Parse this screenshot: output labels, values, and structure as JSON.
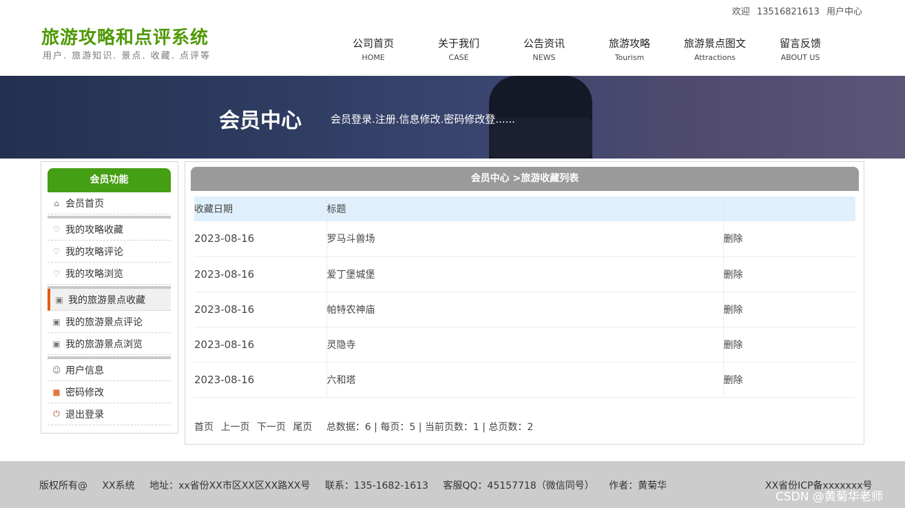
{
  "topbar": {
    "welcome": "欢迎",
    "phone": "13516821613",
    "user_center": "用户中心"
  },
  "header": {
    "title": "旅游攻略和点评系统",
    "subtitle": "用户. 旅游知识. 景点. 收藏. 点评等"
  },
  "nav": [
    {
      "cn": "公司首页",
      "en": "HOME"
    },
    {
      "cn": "关于我们",
      "en": "CASE"
    },
    {
      "cn": "公告资讯",
      "en": "NEWS"
    },
    {
      "cn": "旅游攻略",
      "en": "Tourism"
    },
    {
      "cn": "旅游景点图文",
      "en": "Attractions"
    },
    {
      "cn": "留言反馈",
      "en": "ABOUT US"
    }
  ],
  "banner": {
    "title": "会员中心",
    "desc": "会员登录.注册.信息修改.密码修改登......"
  },
  "sidebar": {
    "header": "会员功能",
    "items": [
      {
        "label": "会员首页",
        "icon": "home-icon"
      },
      {
        "label": "我的攻略收藏",
        "icon": "tulip-icon"
      },
      {
        "label": "我的攻略评论",
        "icon": "tulip-icon"
      },
      {
        "label": "我的攻略浏览",
        "icon": "tulip-icon"
      },
      {
        "label": "我的旅游景点收藏",
        "icon": "wallet-icon"
      },
      {
        "label": "我的旅游景点评论",
        "icon": "wallet-icon"
      },
      {
        "label": "我的旅游景点浏览",
        "icon": "wallet-icon"
      },
      {
        "label": "用户信息",
        "icon": "user-icon"
      },
      {
        "label": "密码修改",
        "icon": "lock-icon"
      },
      {
        "label": "退出登录",
        "icon": "power-icon"
      }
    ]
  },
  "content": {
    "header": "会员中心 >旅游收藏列表",
    "columns": [
      "收藏日期",
      "标题",
      ""
    ],
    "rows": [
      {
        "date": "2023-08-16",
        "title": "罗马斗兽场",
        "action": "删除"
      },
      {
        "date": "2023-08-16",
        "title": "爱丁堡城堡",
        "action": "删除"
      },
      {
        "date": "2023-08-16",
        "title": "帕特农神庙",
        "action": "删除"
      },
      {
        "date": "2023-08-16",
        "title": "灵隐寺",
        "action": "删除"
      },
      {
        "date": "2023-08-16",
        "title": "六和塔",
        "action": "删除"
      }
    ],
    "pager": {
      "first": "首页",
      "prev": "上一页",
      "next": "下一页",
      "last": "尾页",
      "stats": "总数据：6 | 每页：5 | 当前页数：1 | 总页数：2"
    }
  },
  "footer": {
    "copyright": "版权所有@",
    "system": "XX系统",
    "address": "地址：xx省份XX市区XX区XX路XX号",
    "contact": "联系：135-1682-1613",
    "qq": "客服QQ：45157718（微信同号）",
    "author": "作者：黄菊华",
    "icp": "XX省份ICP备xxxxxxx号",
    "watermark": "CSDN @黄菊华老师"
  }
}
